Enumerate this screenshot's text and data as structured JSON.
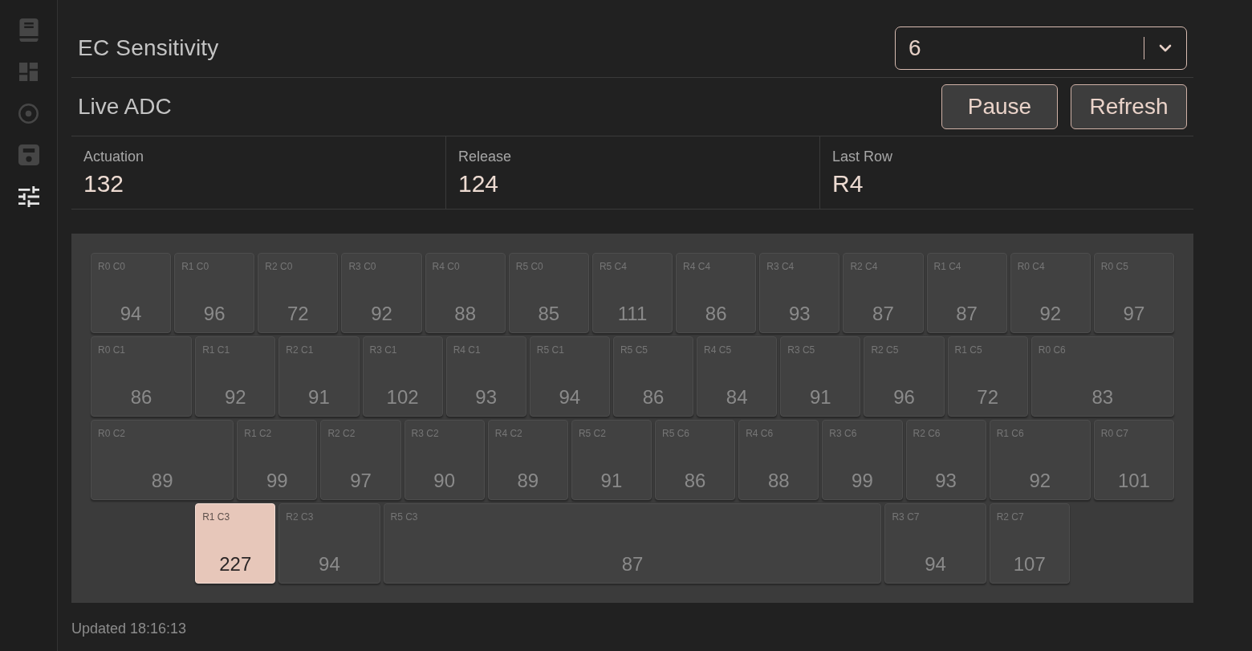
{
  "sidebar": {
    "items": [
      {
        "selected": false
      },
      {
        "selected": false
      },
      {
        "selected": false
      },
      {
        "selected": false
      },
      {
        "selected": true
      }
    ]
  },
  "ec_sensitivity": {
    "label": "EC Sensitivity",
    "dropdown": {
      "value": "6"
    }
  },
  "live_adc": {
    "title": "Live ADC",
    "buttons": [
      "Pause",
      "Refresh"
    ]
  },
  "stats": [
    {
      "label": "Actuation",
      "value": "132"
    },
    {
      "label": "Release",
      "value": "124"
    },
    {
      "label": "Last Row",
      "value": "R4"
    }
  ],
  "keyboard": {
    "rows": [
      {
        "keys": [
          {
            "label": "R0 C0",
            "value": "94",
            "active": false
          },
          {
            "label": "R1 C0",
            "value": "96",
            "active": false
          },
          {
            "label": "R2 C0",
            "value": "72",
            "active": false
          },
          {
            "label": "R3 C0",
            "value": "92",
            "active": false
          },
          {
            "label": "R4 C0",
            "value": "88",
            "active": false
          },
          {
            "label": "R5 C0",
            "value": "85",
            "active": false
          },
          {
            "label": "R5 C4",
            "value": "111",
            "active": false
          },
          {
            "label": "R4 C4",
            "value": "86",
            "active": false
          },
          {
            "label": "R3 C4",
            "value": "93",
            "active": false
          },
          {
            "label": "R2 C4",
            "value": "87",
            "active": false
          },
          {
            "label": "R1 C4",
            "value": "87",
            "active": false
          },
          {
            "label": "R0 C4",
            "value": "92",
            "active": false
          },
          {
            "label": "R0 C5",
            "value": "97",
            "active": false
          }
        ]
      },
      {
        "keys": [
          {
            "label": "R0 C1",
            "value": "86",
            "active": false
          },
          {
            "label": "R1 C1",
            "value": "92",
            "active": false
          },
          {
            "label": "R2 C1",
            "value": "91",
            "active": false
          },
          {
            "label": "R3 C1",
            "value": "102",
            "active": false
          },
          {
            "label": "R4 C1",
            "value": "93",
            "active": false
          },
          {
            "label": "R5 C1",
            "value": "94",
            "active": false
          },
          {
            "label": "R5 C5",
            "value": "86",
            "active": false
          },
          {
            "label": "R4 C5",
            "value": "84",
            "active": false
          },
          {
            "label": "R3 C5",
            "value": "91",
            "active": false
          },
          {
            "label": "R2 C5",
            "value": "96",
            "active": false
          },
          {
            "label": "R1 C5",
            "value": "72",
            "active": false
          },
          {
            "label": "R0 C6",
            "value": "83",
            "active": false
          }
        ]
      },
      {
        "keys": [
          {
            "label": "R0 C2",
            "value": "89",
            "active": false
          },
          {
            "label": "R1 C2",
            "value": "99",
            "active": false
          },
          {
            "label": "R2 C2",
            "value": "97",
            "active": false
          },
          {
            "label": "R3 C2",
            "value": "90",
            "active": false
          },
          {
            "label": "R4 C2",
            "value": "89",
            "active": false
          },
          {
            "label": "R5 C2",
            "value": "91",
            "active": false
          },
          {
            "label": "R5 C6",
            "value": "86",
            "active": false
          },
          {
            "label": "R4 C6",
            "value": "88",
            "active": false
          },
          {
            "label": "R3 C6",
            "value": "99",
            "active": false
          },
          {
            "label": "R2 C6",
            "value": "93",
            "active": false
          },
          {
            "label": "R1 C6",
            "value": "92",
            "active": false
          },
          {
            "label": "R0 C7",
            "value": "101",
            "active": false
          }
        ]
      },
      {
        "keys": [
          {
            "label": "R1 C3",
            "value": "227",
            "active": true
          },
          {
            "label": "R2 C3",
            "value": "94",
            "active": false
          },
          {
            "label": "R5 C3",
            "value": "87",
            "active": false
          },
          {
            "label": "R3 C7",
            "value": "94",
            "active": false
          },
          {
            "label": "R2 C7",
            "value": "107",
            "active": false
          }
        ]
      }
    ]
  },
  "status": {
    "updated": "Updated 18:16:13"
  }
}
